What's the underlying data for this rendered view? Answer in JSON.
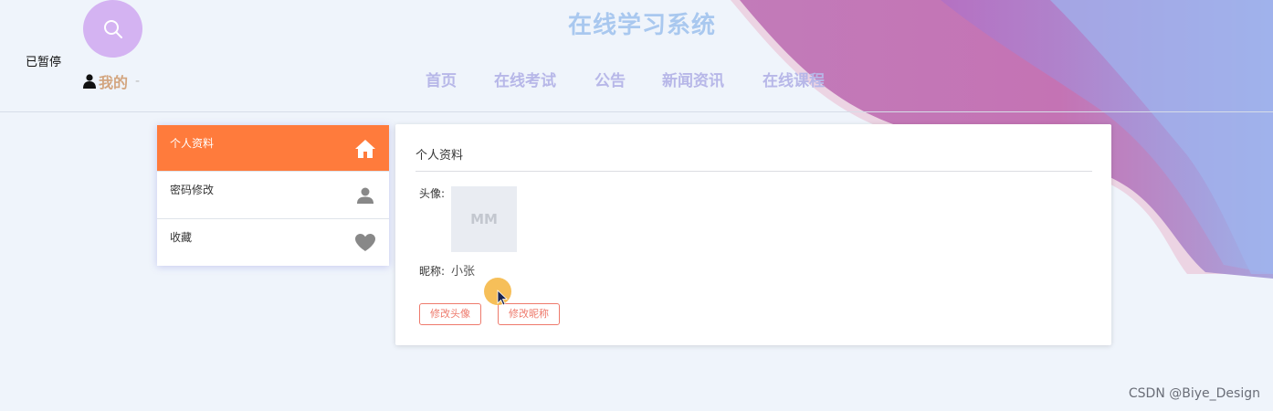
{
  "header": {
    "title": "在线学习系统",
    "paused_label": "已暂停",
    "my_label": "我的",
    "my_dash": "-",
    "nav": [
      {
        "label": "首页"
      },
      {
        "label": "在线考试"
      },
      {
        "label": "公告"
      },
      {
        "label": "新闻资讯"
      },
      {
        "label": "在线课程"
      }
    ]
  },
  "sidebar": {
    "items": [
      {
        "label": "个人资料",
        "icon": "home-icon",
        "active": true
      },
      {
        "label": "密码修改",
        "icon": "user-icon",
        "active": false
      },
      {
        "label": "收藏",
        "icon": "heart-icon",
        "active": false
      }
    ]
  },
  "profile": {
    "title": "个人资料",
    "avatar_label": "头像:",
    "avatar_placeholder": "MM",
    "nickname_label": "昵称:",
    "nickname_value": "小张",
    "buttons": {
      "change_avatar": "修改头像",
      "change_nickname": "修改昵称"
    }
  },
  "watermark": "CSDN @Biye_Design",
  "colors": {
    "accent": "#ff7b3c",
    "button_border": "#ee7a6c",
    "nav_text": "#b7b7e8",
    "title_text": "#a9c8ef",
    "background": "#eff4fb"
  }
}
